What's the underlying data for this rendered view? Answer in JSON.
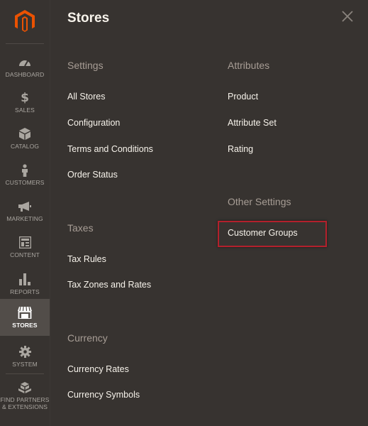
{
  "sidebar": {
    "items": [
      {
        "id": "dashboard",
        "label": "Dashboard",
        "icon": "dashboard-icon"
      },
      {
        "id": "sales",
        "label": "Sales",
        "icon": "dollar-icon"
      },
      {
        "id": "catalog",
        "label": "Catalog",
        "icon": "box-icon"
      },
      {
        "id": "customers",
        "label": "Customers",
        "icon": "person-icon"
      },
      {
        "id": "marketing",
        "label": "Marketing",
        "icon": "megaphone-icon"
      },
      {
        "id": "content",
        "label": "Content",
        "icon": "layout-icon"
      },
      {
        "id": "reports",
        "label": "Reports",
        "icon": "bar-chart-icon"
      },
      {
        "id": "stores",
        "label": "Stores",
        "icon": "storefront-icon",
        "active": true
      },
      {
        "id": "system",
        "label": "System",
        "icon": "gear-icon"
      },
      {
        "id": "partners",
        "label": "Find Partners & Extensions",
        "icon": "cubes-icon"
      }
    ],
    "sales_symbol": "$"
  },
  "panel": {
    "title": "Stores",
    "close_glyph": "×",
    "sections": {
      "settings": {
        "title": "Settings",
        "links": [
          "All Stores",
          "Configuration",
          "Terms and Conditions",
          "Order Status"
        ]
      },
      "taxes": {
        "title": "Taxes",
        "links": [
          "Tax Rules",
          "Tax Zones and Rates"
        ]
      },
      "currency": {
        "title": "Currency",
        "links": [
          "Currency Rates",
          "Currency Symbols"
        ]
      },
      "attributes": {
        "title": "Attributes",
        "links": [
          "Product",
          "Attribute Set",
          "Rating"
        ]
      },
      "other": {
        "title": "Other Settings",
        "links": [
          "Customer Groups"
        ]
      }
    }
  },
  "colors": {
    "background": "#373330",
    "active_item": "#524d49",
    "logo_orange": "#eb5202",
    "highlight_border": "#b3202c",
    "section_title": "#a79d95",
    "link_text": "#f7f3eb"
  }
}
